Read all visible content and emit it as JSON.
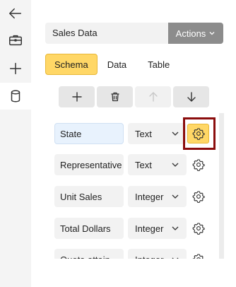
{
  "rail": {
    "items": [
      {
        "name": "back",
        "icon": "arrow-left-icon"
      },
      {
        "name": "briefcase",
        "icon": "briefcase-icon"
      },
      {
        "name": "add",
        "icon": "plus-icon"
      },
      {
        "name": "database",
        "icon": "database-icon",
        "active": true
      }
    ]
  },
  "header": {
    "title_value": "Sales Data",
    "actions_label": "Actions"
  },
  "tabs": [
    {
      "label": "Schema",
      "selected": true
    },
    {
      "label": "Data",
      "selected": false
    },
    {
      "label": "Table",
      "selected": false
    }
  ],
  "toolbar": {
    "buttons": [
      {
        "name": "add-field",
        "icon": "plus-icon",
        "enabled": true
      },
      {
        "name": "delete-field",
        "icon": "trash-icon",
        "enabled": true
      },
      {
        "name": "move-up",
        "icon": "arrow-up-icon",
        "enabled": false
      },
      {
        "name": "move-down",
        "icon": "arrow-down-icon",
        "enabled": true
      }
    ]
  },
  "fields": [
    {
      "name": "State",
      "type": "Text"
    },
    {
      "name": "Representative",
      "type": "Text"
    },
    {
      "name": "Unit Sales",
      "type": "Integer"
    },
    {
      "name": "Total Dollars",
      "type": "Integer"
    },
    {
      "name": "Quota attain",
      "type": "Integer"
    }
  ],
  "colors": {
    "accent": "#ffd766",
    "accent_border": "#e8b838",
    "actions_bg": "#8c8c8c",
    "focus_ring": "#8b0d0d",
    "field_bg": "#f2f2f2",
    "field_focus_bg": "#e8f2fd"
  }
}
